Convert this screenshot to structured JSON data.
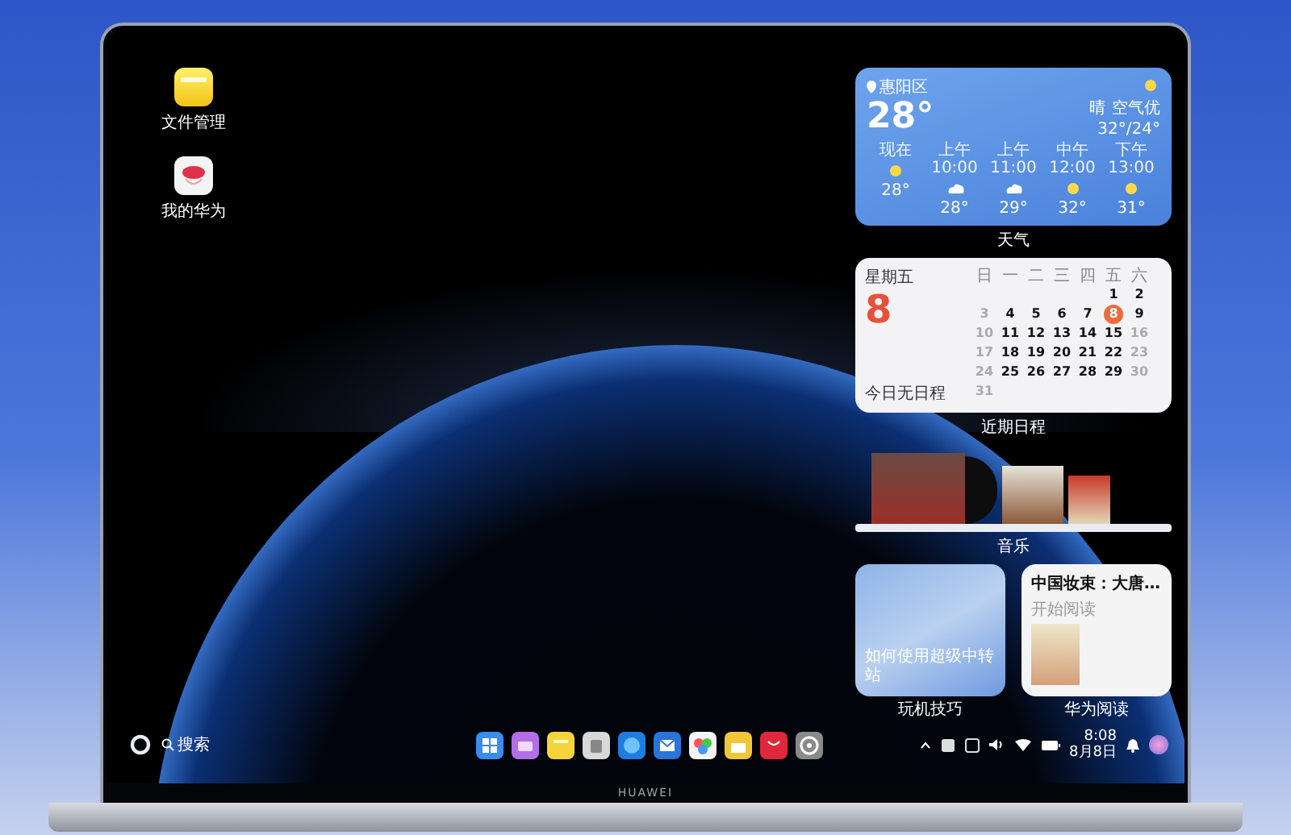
{
  "desktop_icons": [
    {
      "label": "文件管理",
      "kind": "files"
    },
    {
      "label": "我的华为",
      "kind": "huawei"
    }
  ],
  "weather": {
    "location": "惠阳区",
    "temperature": "28°",
    "condition": "晴",
    "air": "空气优",
    "range": "32°/24°",
    "hours": [
      {
        "time": "现在",
        "kind": "sun",
        "temp": "28°"
      },
      {
        "time": "上午10:00",
        "kind": "cloud",
        "temp": "28°"
      },
      {
        "time": "上午11:00",
        "kind": "cloud",
        "temp": "29°"
      },
      {
        "time": "中午12:00",
        "kind": "sun",
        "temp": "32°"
      },
      {
        "time": "下午13:00",
        "kind": "sun",
        "temp": "31°"
      }
    ],
    "label": "天气"
  },
  "calendar": {
    "weekday": "星期五",
    "day": "8",
    "agenda": "今日无日程",
    "weekdays": [
      "日",
      "一",
      "二",
      "三",
      "四",
      "五",
      "六"
    ],
    "weeks": [
      [
        {
          "day": "1",
          "muted": false,
          "selected": false
        },
        {
          "day": "2",
          "muted": false,
          "selected": false
        }
      ],
      [
        {
          "day": "3",
          "muted": true,
          "selected": false
        },
        {
          "day": "4",
          "muted": false,
          "selected": false
        },
        {
          "day": "5",
          "muted": false,
          "selected": false
        },
        {
          "day": "6",
          "muted": false,
          "selected": false
        },
        {
          "day": "7",
          "muted": false,
          "selected": false
        },
        {
          "day": "8",
          "muted": false,
          "selected": true
        },
        {
          "day": "9",
          "muted": false,
          "selected": false
        }
      ],
      [
        {
          "day": "10",
          "muted": true,
          "selected": false
        },
        {
          "day": "11",
          "muted": false,
          "selected": false
        },
        {
          "day": "12",
          "muted": false,
          "selected": false
        },
        {
          "day": "13",
          "muted": false,
          "selected": false
        },
        {
          "day": "14",
          "muted": false,
          "selected": false
        },
        {
          "day": "15",
          "muted": false,
          "selected": false
        },
        {
          "day": "16",
          "muted": true,
          "selected": false
        }
      ],
      [
        {
          "day": "17",
          "muted": true,
          "selected": false
        },
        {
          "day": "18",
          "muted": false,
          "selected": false
        },
        {
          "day": "19",
          "muted": false,
          "selected": false
        },
        {
          "day": "20",
          "muted": false,
          "selected": false
        },
        {
          "day": "21",
          "muted": false,
          "selected": false
        },
        {
          "day": "22",
          "muted": false,
          "selected": false
        },
        {
          "day": "23",
          "muted": true,
          "selected": false
        }
      ],
      [
        {
          "day": "24",
          "muted": true,
          "selected": false
        },
        {
          "day": "25",
          "muted": false,
          "selected": false
        },
        {
          "day": "26",
          "muted": false,
          "selected": false
        },
        {
          "day": "27",
          "muted": false,
          "selected": false
        },
        {
          "day": "28",
          "muted": false,
          "selected": false
        },
        {
          "day": "29",
          "muted": false,
          "selected": false
        },
        {
          "day": "30",
          "muted": true,
          "selected": false
        }
      ],
      [
        {
          "day": "31",
          "muted": true,
          "selected": false
        }
      ]
    ],
    "label": "近期日程"
  },
  "music": {
    "label": "音乐"
  },
  "tips": {
    "caption": "如何使用超级中转站",
    "label": "玩机技巧"
  },
  "reading": {
    "title": "中国妆束：大唐…",
    "subtitle": "开始阅读",
    "label": "华为阅读"
  },
  "taskbar": {
    "search": "搜索",
    "apps": [
      {
        "kind": "launcher"
      },
      {
        "kind": "files"
      },
      {
        "kind": "notes"
      },
      {
        "kind": "trash"
      },
      {
        "kind": "browser"
      },
      {
        "kind": "mail"
      },
      {
        "kind": "gallery"
      },
      {
        "kind": "memo"
      },
      {
        "kind": "store"
      },
      {
        "kind": "settings"
      }
    ],
    "time": "8:08",
    "date": "8月8日"
  },
  "brand": "HUAWEI"
}
